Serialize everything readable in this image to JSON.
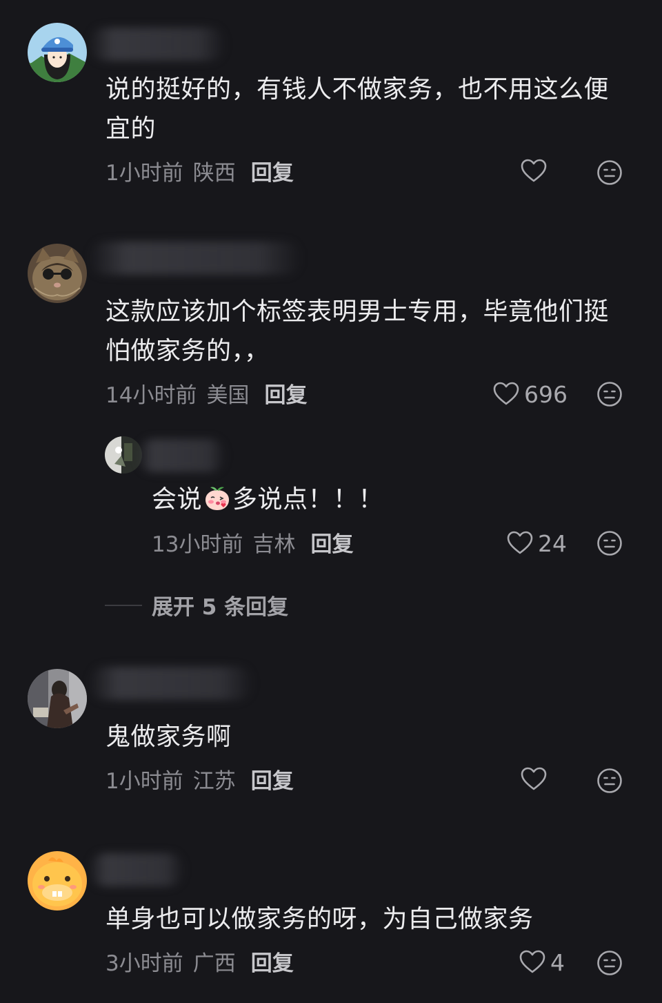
{
  "comments": [
    {
      "text": "说的挺好的，有钱人不做家务，也不用这么便宜的",
      "time": "1小时前",
      "location": "陕西",
      "reply_label": "回复",
      "likes": ""
    },
    {
      "text": "这款应该加个标签表明男士专用，毕竟他们挺怕做家务的，，",
      "time": "14小时前",
      "location": "美国",
      "reply_label": "回复",
      "likes": "696",
      "sub_reply": {
        "text_before": "会说",
        "emoji": "blushing-peach-emoji",
        "text_after": "多说点！！！",
        "time": "13小时前",
        "location": "吉林",
        "reply_label": "回复",
        "likes": "24"
      },
      "expand_label": "展开 5 条回复"
    },
    {
      "text": "鬼做家务啊",
      "time": "1小时前",
      "location": "江苏",
      "reply_label": "回复",
      "likes": ""
    },
    {
      "text": "单身也可以做家务的呀，为自己做家务",
      "time": "3小时前",
      "location": "广西",
      "reply_label": "回复",
      "likes": "4"
    }
  ],
  "icons": {
    "like": "heart-outline-icon",
    "emoji": "neutral-face-icon"
  },
  "colors": {
    "background": "#17171b",
    "text": "#ececee",
    "meta": "#8c8c92"
  }
}
